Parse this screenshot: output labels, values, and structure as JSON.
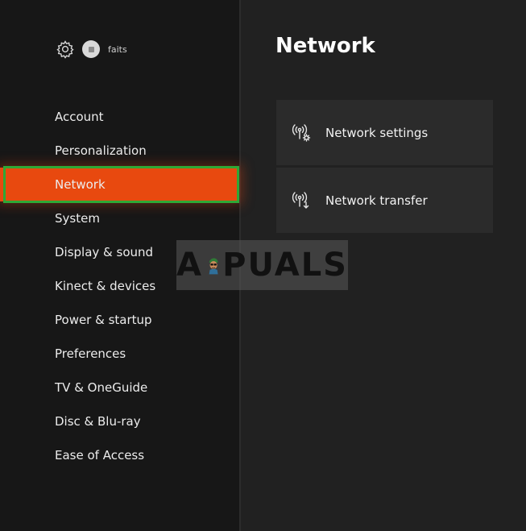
{
  "profile": {
    "gamertag": "faits",
    "icon": "gear-icon"
  },
  "sidebar": {
    "items": [
      {
        "label": "Account",
        "selected": false
      },
      {
        "label": "Personalization",
        "selected": false
      },
      {
        "label": "Network",
        "selected": true
      },
      {
        "label": "System",
        "selected": false
      },
      {
        "label": "Display & sound",
        "selected": false
      },
      {
        "label": "Kinect & devices",
        "selected": false
      },
      {
        "label": "Power & startup",
        "selected": false
      },
      {
        "label": "Preferences",
        "selected": false
      },
      {
        "label": "TV & OneGuide",
        "selected": false
      },
      {
        "label": "Disc & Blu-ray",
        "selected": false
      },
      {
        "label": "Ease of Access",
        "selected": false
      }
    ]
  },
  "main": {
    "title": "Network",
    "tiles": [
      {
        "label": "Network settings",
        "icon": "network-settings-icon"
      },
      {
        "label": "Network transfer",
        "icon": "network-transfer-icon"
      }
    ]
  },
  "watermark": {
    "text_left": "A",
    "text_right": "PUALS"
  },
  "colors": {
    "background": "#212121",
    "sidebar": "#171717",
    "selected": "#e8490f",
    "highlight_border": "#2ea836",
    "tile": "#2b2b2b"
  }
}
